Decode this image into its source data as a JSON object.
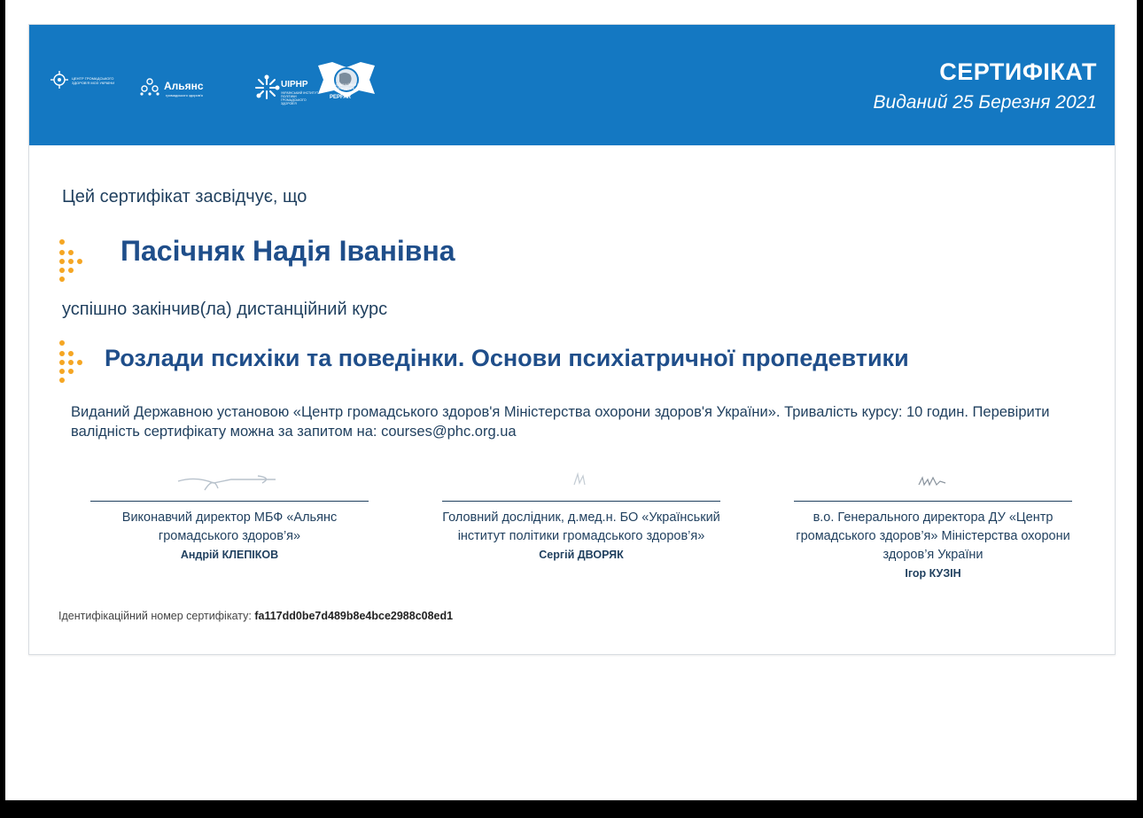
{
  "header": {
    "title": "СЕРТИФІКАТ",
    "issued_date": "Виданий 25 Березня 2021",
    "logos": {
      "phc": "ЦЕНТР ГРОМАДСЬКОГО ЗДОРОВ'Я МОЗ УКРАЇНИ",
      "alliance": "Альянс",
      "alliance_sub": "громадського здоров'я",
      "uiphp": "UIPHP",
      "uiphp_sub": "УКРАЇНСЬКИЙ ІНСТИТУТ ПОЛІТИКИ ГРОМАДСЬКОГО ЗДОРОВ'Я",
      "pepfar": "PEPFAR",
      "pepfar_sub": "НАДЗВИЧАЙНИЙ ПЛАН ПРЕЗИДЕНТА США"
    }
  },
  "body": {
    "intro": "Цей сертифікат засвідчує, що",
    "recipient": "Пасічняк Надія Іванівна",
    "completed": "успішно закінчив(ла) дистанційний курс",
    "course": "Розлади психіки та поведінки. Основи психіатричної пропедевтики",
    "issued_text": "Виданий Державною установою «Центр громадського здоров'я Міністерства охорони здоров'я України». Тривалість курсу: 10 годин. Перевірити валідність сертифікату можна за запитом на: courses@phc.org.ua"
  },
  "signatures": [
    {
      "role": "Виконавчий директор МБФ «Альянс громадського здоров’я»",
      "name": "Андрій КЛЕПІКОВ"
    },
    {
      "role": "Головний дослідник, д.мед.н. БО «Український інститут політики громадського здоров’я»",
      "name": "Сергій ДВОРЯК"
    },
    {
      "role": "в.о. Генерального директора ДУ «Центр громадського здоров’я» Міністерства охорони здоров’я України",
      "name": "Ігор КУЗІН"
    }
  ],
  "footer": {
    "id_label": "Ідентифікаційний номер сертифікату:",
    "id_value": "fa117dd0be7d489b8e4bce2988c08ed1"
  },
  "colors": {
    "banner": "#1478c2",
    "accent_dots": "#f5a623",
    "heading_blue": "#1f4e8a",
    "text": "#1f3f5e"
  }
}
